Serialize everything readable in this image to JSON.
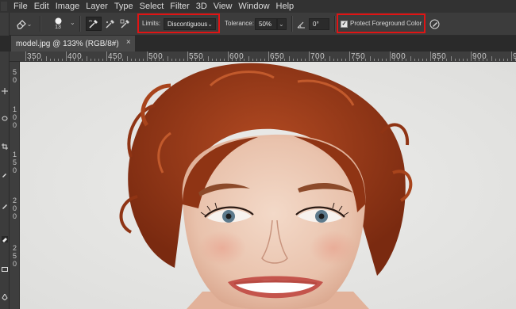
{
  "menu": [
    "File",
    "Edit",
    "Image",
    "Layer",
    "Type",
    "Select",
    "Filter",
    "3D",
    "View",
    "Window",
    "Help"
  ],
  "options": {
    "brush_size": "13",
    "limits_label": "Limits:",
    "limits_value": "Discontiguous",
    "tolerance_label": "Tolerance:",
    "tolerance_value": "50%",
    "angle_value": "0°",
    "protect_label": "Protect Foreground Color",
    "protect_checked": true
  },
  "document_tab": {
    "title": "model.jpg @ 133% (RGB/8#)",
    "close": "×"
  },
  "ruler": {
    "horizontal": [
      "350",
      "400",
      "450",
      "500",
      "550",
      "600",
      "650",
      "700",
      "750",
      "800",
      "850",
      "900",
      "950"
    ],
    "vertical": [
      [
        "5",
        "0"
      ],
      [
        "1",
        "0",
        "0"
      ],
      [
        "1",
        "5",
        "0"
      ],
      [
        "2",
        "0",
        "0"
      ],
      [
        "2",
        "5",
        "0"
      ]
    ]
  },
  "colors": {
    "highlight": "#e01414",
    "app_bg": "#535353",
    "menu_bg": "#323232"
  }
}
